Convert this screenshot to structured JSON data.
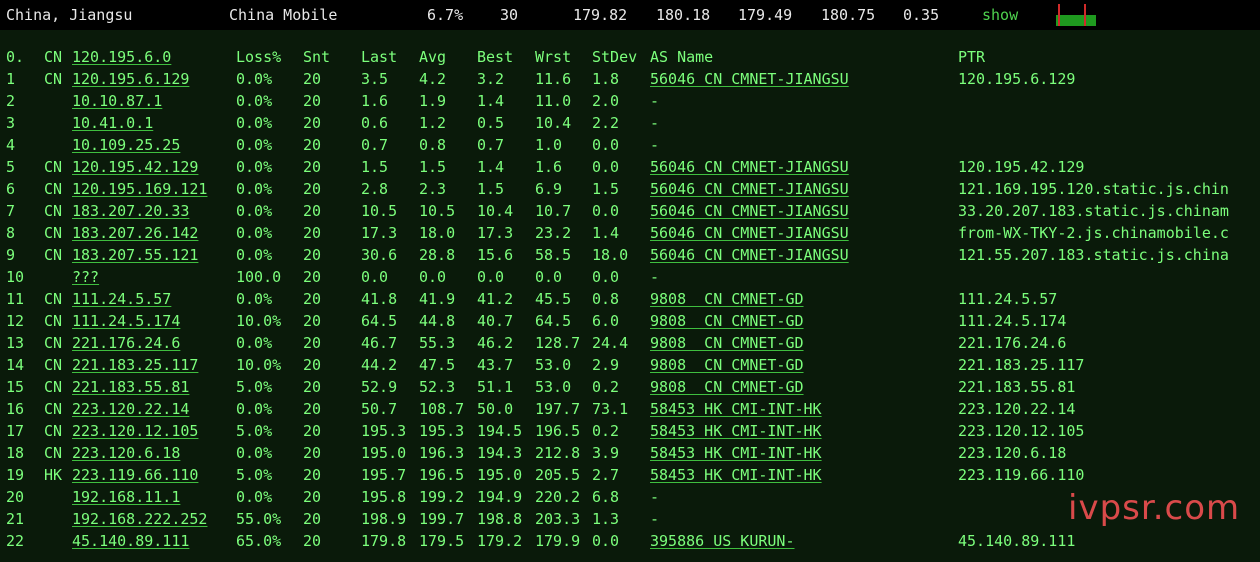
{
  "topbar": {
    "location": "China, Jiangsu",
    "isp": "China Mobile",
    "loss": "6.7%",
    "snt": "30",
    "last": "179.82",
    "avg": "180.18",
    "best": "179.49",
    "wrst": "180.75",
    "stdev": "0.35",
    "show_label": "show"
  },
  "header": {
    "hop": "0.",
    "cc": "CN",
    "host": "120.195.6.0",
    "loss": "Loss%",
    "snt": "Snt",
    "last": "Last",
    "avg": "Avg",
    "best": "Best",
    "wrst": "Wrst",
    "stdev": "StDev",
    "as": "AS Name",
    "ptr": "PTR"
  },
  "rows": [
    {
      "hop": "1",
      "cc": "CN",
      "host": "120.195.6.129",
      "loss": "0.0%",
      "snt": "20",
      "last": "3.5",
      "avg": "4.2",
      "best": "3.2",
      "wrst": "11.6",
      "stdev": "1.8",
      "as": "56046 CN CMNET-JIANGSU",
      "ptr": "120.195.6.129"
    },
    {
      "hop": "2",
      "cc": "",
      "host": "10.10.87.1",
      "loss": "0.0%",
      "snt": "20",
      "last": "1.6",
      "avg": "1.9",
      "best": "1.4",
      "wrst": "11.0",
      "stdev": "2.0",
      "as": "-",
      "ptr": ""
    },
    {
      "hop": "3",
      "cc": "",
      "host": "10.41.0.1",
      "loss": "0.0%",
      "snt": "20",
      "last": "0.6",
      "avg": "1.2",
      "best": "0.5",
      "wrst": "10.4",
      "stdev": "2.2",
      "as": "-",
      "ptr": ""
    },
    {
      "hop": "4",
      "cc": "",
      "host": "10.109.25.25",
      "loss": "0.0%",
      "snt": "20",
      "last": "0.7",
      "avg": "0.8",
      "best": "0.7",
      "wrst": "1.0",
      "stdev": "0.0",
      "as": "-",
      "ptr": ""
    },
    {
      "hop": "5",
      "cc": "CN",
      "host": "120.195.42.129",
      "loss": "0.0%",
      "snt": "20",
      "last": "1.5",
      "avg": "1.5",
      "best": "1.4",
      "wrst": "1.6",
      "stdev": "0.0",
      "as": "56046 CN CMNET-JIANGSU",
      "ptr": "120.195.42.129"
    },
    {
      "hop": "6",
      "cc": "CN",
      "host": "120.195.169.121",
      "loss": "0.0%",
      "snt": "20",
      "last": "2.8",
      "avg": "2.3",
      "best": "1.5",
      "wrst": "6.9",
      "stdev": "1.5",
      "as": "56046 CN CMNET-JIANGSU",
      "ptr": "121.169.195.120.static.js.chin"
    },
    {
      "hop": "7",
      "cc": "CN",
      "host": "183.207.20.33",
      "loss": "0.0%",
      "snt": "20",
      "last": "10.5",
      "avg": "10.5",
      "best": "10.4",
      "wrst": "10.7",
      "stdev": "0.0",
      "as": "56046 CN CMNET-JIANGSU",
      "ptr": "33.20.207.183.static.js.chinam"
    },
    {
      "hop": "8",
      "cc": "CN",
      "host": "183.207.26.142",
      "loss": "0.0%",
      "snt": "20",
      "last": "17.3",
      "avg": "18.0",
      "best": "17.3",
      "wrst": "23.2",
      "stdev": "1.4",
      "as": "56046 CN CMNET-JIANGSU",
      "ptr": "from-WX-TKY-2.js.chinamobile.c"
    },
    {
      "hop": "9",
      "cc": "CN",
      "host": "183.207.55.121",
      "loss": "0.0%",
      "snt": "20",
      "last": "30.6",
      "avg": "28.8",
      "best": "15.6",
      "wrst": "58.5",
      "stdev": "18.0",
      "as": "56046 CN CMNET-JIANGSU",
      "ptr": "121.55.207.183.static.js.china"
    },
    {
      "hop": "10",
      "cc": "",
      "host": "???",
      "loss": "100.0",
      "snt": "20",
      "last": "0.0",
      "avg": "0.0",
      "best": "0.0",
      "wrst": "0.0",
      "stdev": "0.0",
      "as": "-",
      "ptr": ""
    },
    {
      "hop": "11",
      "cc": "CN",
      "host": "111.24.5.57",
      "loss": "0.0%",
      "snt": "20",
      "last": "41.8",
      "avg": "41.9",
      "best": "41.2",
      "wrst": "45.5",
      "stdev": "0.8",
      "as": "9808  CN CMNET-GD",
      "ptr": "111.24.5.57"
    },
    {
      "hop": "12",
      "cc": "CN",
      "host": "111.24.5.174",
      "loss": "10.0%",
      "snt": "20",
      "last": "64.5",
      "avg": "44.8",
      "best": "40.7",
      "wrst": "64.5",
      "stdev": "6.0",
      "as": "9808  CN CMNET-GD",
      "ptr": "111.24.5.174"
    },
    {
      "hop": "13",
      "cc": "CN",
      "host": "221.176.24.6",
      "loss": "0.0%",
      "snt": "20",
      "last": "46.7",
      "avg": "55.3",
      "best": "46.2",
      "wrst": "128.7",
      "stdev": "24.4",
      "as": "9808  CN CMNET-GD",
      "ptr": "221.176.24.6"
    },
    {
      "hop": "14",
      "cc": "CN",
      "host": "221.183.25.117",
      "loss": "10.0%",
      "snt": "20",
      "last": "44.2",
      "avg": "47.5",
      "best": "43.7",
      "wrst": "53.0",
      "stdev": "2.9",
      "as": "9808  CN CMNET-GD",
      "ptr": "221.183.25.117"
    },
    {
      "hop": "15",
      "cc": "CN",
      "host": "221.183.55.81",
      "loss": "5.0%",
      "snt": "20",
      "last": "52.9",
      "avg": "52.3",
      "best": "51.1",
      "wrst": "53.0",
      "stdev": "0.2",
      "as": "9808  CN CMNET-GD",
      "ptr": "221.183.55.81"
    },
    {
      "hop": "16",
      "cc": "CN",
      "host": "223.120.22.14",
      "loss": "0.0%",
      "snt": "20",
      "last": "50.7",
      "avg": "108.7",
      "best": "50.0",
      "wrst": "197.7",
      "stdev": "73.1",
      "as": "58453 HK CMI-INT-HK",
      "ptr": "223.120.22.14"
    },
    {
      "hop": "17",
      "cc": "CN",
      "host": "223.120.12.105",
      "loss": "5.0%",
      "snt": "20",
      "last": "195.3",
      "avg": "195.3",
      "best": "194.5",
      "wrst": "196.5",
      "stdev": "0.2",
      "as": "58453 HK CMI-INT-HK",
      "ptr": "223.120.12.105"
    },
    {
      "hop": "18",
      "cc": "CN",
      "host": "223.120.6.18",
      "loss": "0.0%",
      "snt": "20",
      "last": "195.0",
      "avg": "196.3",
      "best": "194.3",
      "wrst": "212.8",
      "stdev": "3.9",
      "as": "58453 HK CMI-INT-HK",
      "ptr": "223.120.6.18"
    },
    {
      "hop": "19",
      "cc": "HK",
      "host": "223.119.66.110",
      "loss": "5.0%",
      "snt": "20",
      "last": "195.7",
      "avg": "196.5",
      "best": "195.0",
      "wrst": "205.5",
      "stdev": "2.7",
      "as": "58453 HK CMI-INT-HK",
      "ptr": "223.119.66.110"
    },
    {
      "hop": "20",
      "cc": "",
      "host": "192.168.11.1",
      "loss": "0.0%",
      "snt": "20",
      "last": "195.8",
      "avg": "199.2",
      "best": "194.9",
      "wrst": "220.2",
      "stdev": "6.8",
      "as": "-",
      "ptr": ""
    },
    {
      "hop": "21",
      "cc": "",
      "host": "192.168.222.252",
      "loss": "55.0%",
      "snt": "20",
      "last": "198.9",
      "avg": "199.7",
      "best": "198.8",
      "wrst": "203.3",
      "stdev": "1.3",
      "as": "-",
      "ptr": ""
    },
    {
      "hop": "22",
      "cc": "",
      "host": "45.140.89.111",
      "loss": "65.0%",
      "snt": "20",
      "last": "179.8",
      "avg": "179.5",
      "best": "179.2",
      "wrst": "179.9",
      "stdev": "0.0",
      "as": "395886 US KURUN-",
      "ptr": "45.140.89.111"
    }
  ],
  "watermark": "ivpsr.com",
  "colors": {
    "accent": "#7cff7c",
    "background": "#0a1a0a",
    "topbar": "#000000",
    "watermark": "#d94a4a"
  }
}
